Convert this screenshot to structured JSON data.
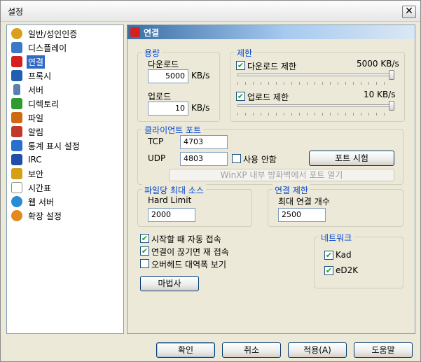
{
  "window": {
    "title": "설정",
    "close_glyph": "✕"
  },
  "sidebar": {
    "items": [
      {
        "label": "일반/성인인증",
        "icon": "gear-icon",
        "color": "#d9a020"
      },
      {
        "label": "디스플레이",
        "icon": "monitor-icon",
        "color": "#3a78c8"
      },
      {
        "label": "연결",
        "icon": "plug-icon",
        "color": "#d42020"
      },
      {
        "label": "프록시",
        "icon": "proxy-icon",
        "color": "#2060b0"
      },
      {
        "label": "서버",
        "icon": "server-icon",
        "color": "#5a7fb0"
      },
      {
        "label": "디렉토리",
        "icon": "folder-icon",
        "color": "#2f9a2f"
      },
      {
        "label": "파일",
        "icon": "file-icon",
        "color": "#d06a10"
      },
      {
        "label": "알림",
        "icon": "notify-icon",
        "color": "#c0392b"
      },
      {
        "label": "통계 표시 설정",
        "icon": "stats-icon",
        "color": "#2a6fcf"
      },
      {
        "label": "IRC",
        "icon": "irc-icon",
        "color": "#1f4fa8"
      },
      {
        "label": "보안",
        "icon": "lock-icon",
        "color": "#d4a017"
      },
      {
        "label": "시간표",
        "icon": "calendar-icon",
        "color": "#8c8c8c"
      },
      {
        "label": "웹 서버",
        "icon": "globe-icon",
        "color": "#2a8ad4"
      },
      {
        "label": "확장 설정",
        "icon": "extension-icon",
        "color": "#e08a20"
      }
    ],
    "selected_index": 2
  },
  "panel": {
    "header": "연결",
    "capacity": {
      "legend": "용량",
      "download_label": "다운로드",
      "download_value": "5000",
      "upload_label": "업로드",
      "upload_value": "10",
      "unit": "KB/s"
    },
    "limits": {
      "legend": "제한",
      "download_limit_label": "다운로드 제한",
      "download_limit_value": "5000 KB/s",
      "download_checked": true,
      "download_slider_fraction": 1.0,
      "upload_limit_label": "업로드 제한",
      "upload_limit_value": "10 KB/s",
      "upload_checked": true,
      "upload_slider_fraction": 1.0
    },
    "client_port": {
      "legend": "클라이언트 포트",
      "tcp_label": "TCP",
      "tcp_value": "4703",
      "udp_label": "UDP",
      "udp_value": "4803",
      "disable_label": "사용 안함",
      "disable_checked": false,
      "test_button": "포트 시험",
      "firewall_button": "WinXP 내부 방화벽에서 포트 열기"
    },
    "max_sources": {
      "legend": "파일당 최대 소스",
      "label": "Hard Limit",
      "value": "2000"
    },
    "conn_limit": {
      "legend": "연결 제한",
      "label": "최대 연결 개수",
      "value": "2500"
    },
    "options": [
      {
        "label": "시작할 때 자동 접속",
        "checked": true
      },
      {
        "label": "연결이 끊기면 재 접속",
        "checked": true
      },
      {
        "label": "오버헤드 대역폭 보기",
        "checked": false
      }
    ],
    "wizard_button": "마법사",
    "network": {
      "legend": "네트워크",
      "items": [
        {
          "label": "Kad",
          "checked": true
        },
        {
          "label": "eD2K",
          "checked": true
        }
      ]
    }
  },
  "footer": {
    "ok": "확인",
    "cancel": "취소",
    "apply": "적용(A)",
    "help": "도움말"
  },
  "colors": {
    "accent": "#0046d5",
    "selection": "#316ac5",
    "check": "#21a121"
  }
}
